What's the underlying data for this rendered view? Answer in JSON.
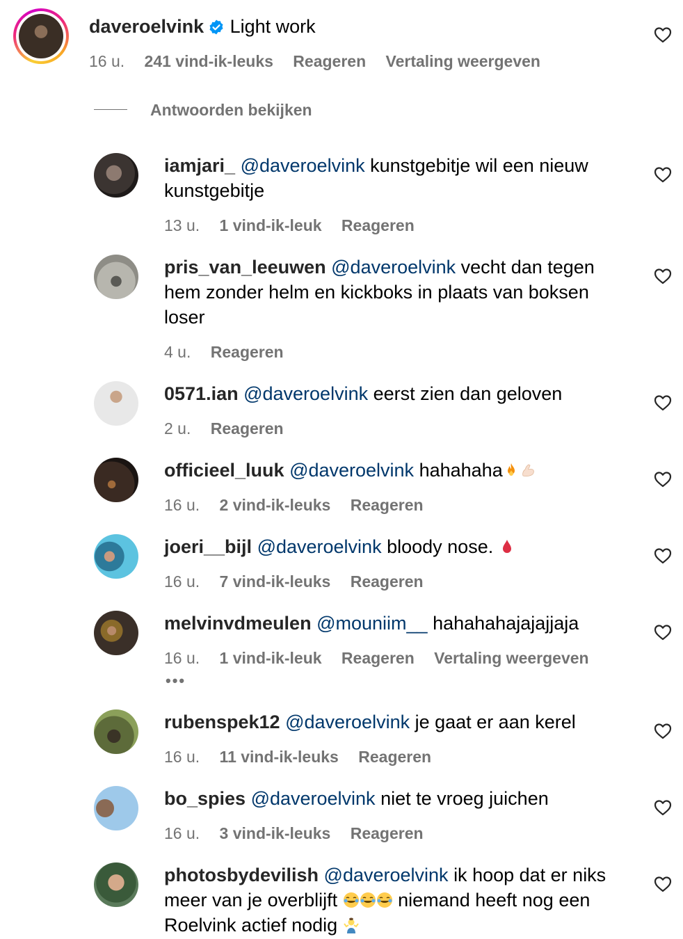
{
  "post": {
    "username": "daveroelvink",
    "caption": "Light work",
    "time": "16 u.",
    "likes": "241 vind-ik-leuks",
    "reply_label": "Reageren",
    "translate_label": "Vertaling weergeven",
    "view_replies": "Antwoorden bekijken"
  },
  "comments": [
    {
      "username": "iamjari_",
      "mention": "@daveroelvink",
      "text1": "kunstgebitje wil een nieuw",
      "text2": "kunstgebitje",
      "time": "13 u.",
      "likes": "1 vind-ik-leuk",
      "reply": "Reageren"
    },
    {
      "username": "pris_van_leeuwen",
      "mention": "@daveroelvink",
      "text1": "vecht dan tegen",
      "text2": "hem zonder helm en kickboks in plaats van boksen",
      "text3": "loser",
      "time": "4 u.",
      "reply": "Reageren"
    },
    {
      "username": "0571.ian",
      "mention": "@daveroelvink",
      "text1": "eerst zien dan geloven",
      "time": "2 u.",
      "reply": "Reageren"
    },
    {
      "username": "officieel_luuk",
      "mention": "@daveroelvink",
      "text1": "hahahaha",
      "time": "16 u.",
      "likes": "2 vind-ik-leuks",
      "reply": "Reageren"
    },
    {
      "username": "joeri__bijl",
      "mention": "@daveroelvink",
      "text1": "bloody nose.",
      "time": "16 u.",
      "likes": "7 vind-ik-leuks",
      "reply": "Reageren"
    },
    {
      "username": "melvinvdmeulen",
      "mention": "@mouniim__",
      "text1": "hahahahajajajjaja",
      "time": "16 u.",
      "likes": "1 vind-ik-leuk",
      "reply": "Reageren",
      "translate": "Vertaling weergeven",
      "more": "•••"
    },
    {
      "username": "rubenspek12",
      "mention": "@daveroelvink",
      "text1": "je gaat er aan kerel",
      "time": "16 u.",
      "likes": "11 vind-ik-leuks",
      "reply": "Reageren"
    },
    {
      "username": "bo_spies",
      "mention": "@daveroelvink",
      "text1": "niet te vroeg juichen",
      "time": "16 u.",
      "likes": "3 vind-ik-leuks",
      "reply": "Reageren"
    },
    {
      "username": "photosbydevilish",
      "mention": "@daveroelvink",
      "text1": "ik hoop dat er niks",
      "text2a": "meer van je overblijft",
      "text2b": "niemand heeft nog een",
      "text3": "Roelvink actief nodig"
    }
  ],
  "colors": {
    "username": "#262626",
    "mention": "#00376b",
    "meta": "#737373",
    "verified": "#0095f6"
  }
}
